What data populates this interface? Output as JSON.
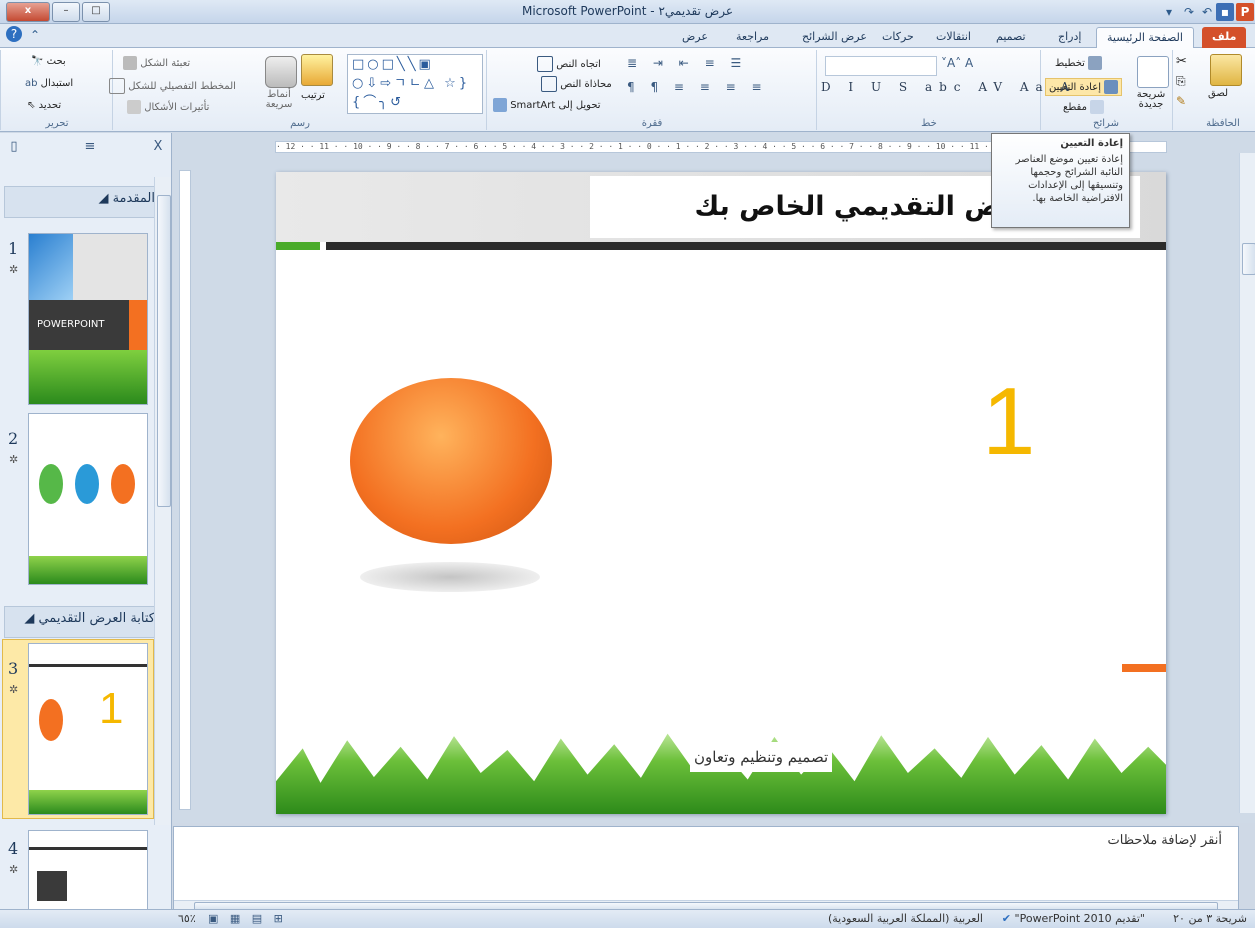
{
  "app": {
    "window_title": "Microsoft PowerPoint - عرض تقديمي٢",
    "window_buttons": {
      "close": "x",
      "minimize": "□",
      "restore": "–"
    }
  },
  "tabs": [
    {
      "label": "ملف"
    },
    {
      "label": "الصفحة الرئيسية"
    },
    {
      "label": "إدراج"
    },
    {
      "label": "تصميم"
    },
    {
      "label": "انتقالات"
    },
    {
      "label": "حركات"
    },
    {
      "label": "عرض الشرائح"
    },
    {
      "label": "مراجعة"
    },
    {
      "label": "عرض"
    }
  ],
  "ribbon": {
    "clipboard": {
      "group": "الحافظة",
      "paste": "لصق"
    },
    "slides": {
      "group": "شرائح",
      "new_slide": "شريحة جديدة",
      "layout": "تخطيط",
      "reset": "إعادة التعيين",
      "section": "مقطع"
    },
    "font": {
      "group": "خط"
    },
    "paragraph": {
      "group": "فقرة",
      "text_direction": "اتجاه النص",
      "align_text": "محاذاة النص",
      "convert_smartart": "تحويل إلى SmartArt"
    },
    "drawing": {
      "group": "رسم",
      "arrange": "ترتيب",
      "quick_styles": "أنماط سريعة",
      "shape_fill": "تعبئة الشكل",
      "shape_outline": "المخطط التفصيلي للشكل",
      "shape_effects": "تأثيرات الأشكال"
    },
    "editing": {
      "group": "تحرير",
      "find": "بحث",
      "replace": "استبدال",
      "select": "تحديد"
    }
  },
  "ruler": {
    "text": "· 12 · · 11 · · 10 · · 9 · · 8 · · 7 · · 6 · · 5 · · 4 · · 3 · · 2 · · 1 · · 0 · · 1 · · 2 · · 3 · · 4 · · 5 · · 6 · · 7 · · 8 · · 9 · · 10 · · 11 · · 12"
  },
  "tooltip": {
    "title": "إعادة التعيين",
    "body": "إعادة تعيين موضع العناصر النائبة الشرائح وحجمها وتنسيقها إلى الإعدادات الافتراضية الخاصة بها."
  },
  "left_pane": {
    "sections": [
      {
        "label": "المقدمة"
      },
      {
        "label": "كتابة العرض التقديمي"
      }
    ],
    "thumbnails": [
      {
        "num": "1",
        "caption": "POWERPOINT ٢٠١٠"
      },
      {
        "num": "2"
      },
      {
        "num": "3"
      },
      {
        "num": "4"
      }
    ]
  },
  "slide": {
    "title": "كاتب العرض التقديمي الخاص بك",
    "big_number": "1",
    "footer_text": "تصميم وتنظيم وتعاون"
  },
  "notes": {
    "placeholder": "أنقر لإضافة ملاحظات"
  },
  "status": {
    "slide_info": "شريحة ٣ من ٢٠",
    "theme": "\"تقديم PowerPoint 2010\"",
    "language": "العربية (المملكة العربية السعودية)",
    "zoom": "٪٦٥"
  },
  "colors": {
    "accent_orange": "#f37021",
    "ribbon_blue": "#1e395b",
    "file_tab": "#d4502a",
    "number_yellow": "#f5b800"
  }
}
